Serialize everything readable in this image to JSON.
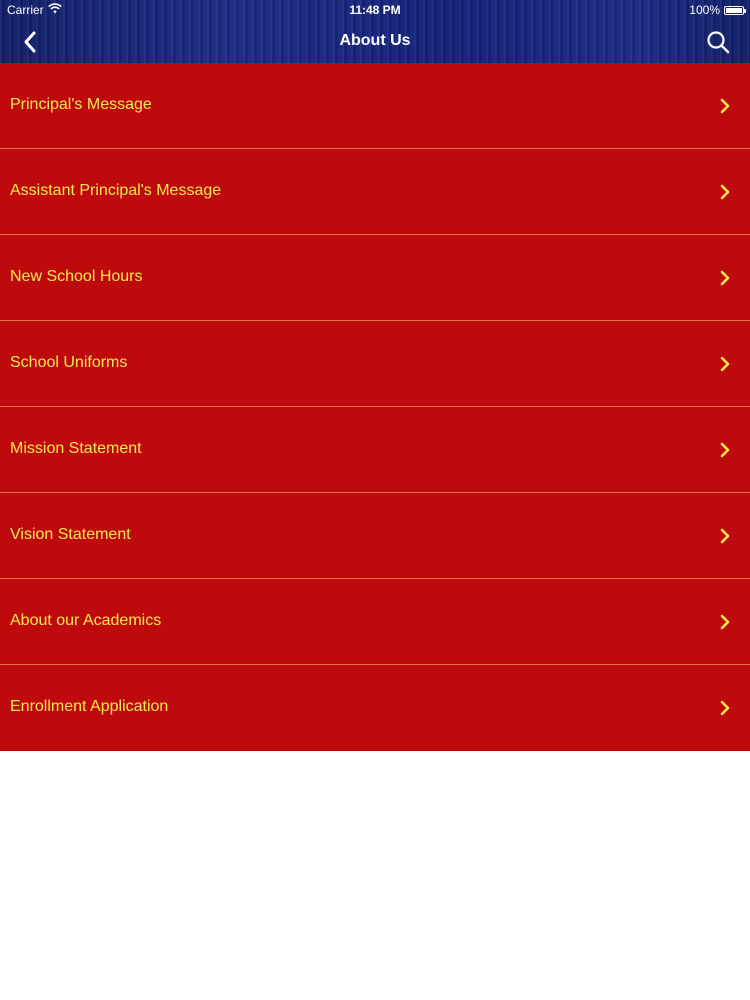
{
  "status_bar": {
    "carrier": "Carrier",
    "time": "11:48 PM",
    "battery": "100%",
    "wifi_icon": "wifi-icon",
    "battery_icon": "battery-icon"
  },
  "nav_bar": {
    "title": "About Us",
    "back_icon": "chevron-left-icon",
    "search_icon": "search-icon"
  },
  "menu": {
    "items": [
      {
        "label": "Principal's Message"
      },
      {
        "label": "Assistant Principal's Message"
      },
      {
        "label": "New School Hours"
      },
      {
        "label": "School Uniforms"
      },
      {
        "label": "Mission Statement"
      },
      {
        "label": "Vision Statement"
      },
      {
        "label": "About our Academics"
      },
      {
        "label": "Enrollment Application"
      }
    ],
    "chevron_icon": "chevron-right-icon"
  },
  "colors": {
    "nav_background": "#1a2b85",
    "row_background": "#bf0a0d",
    "row_text": "#f9e94a",
    "row_divider": "#e2703a"
  }
}
